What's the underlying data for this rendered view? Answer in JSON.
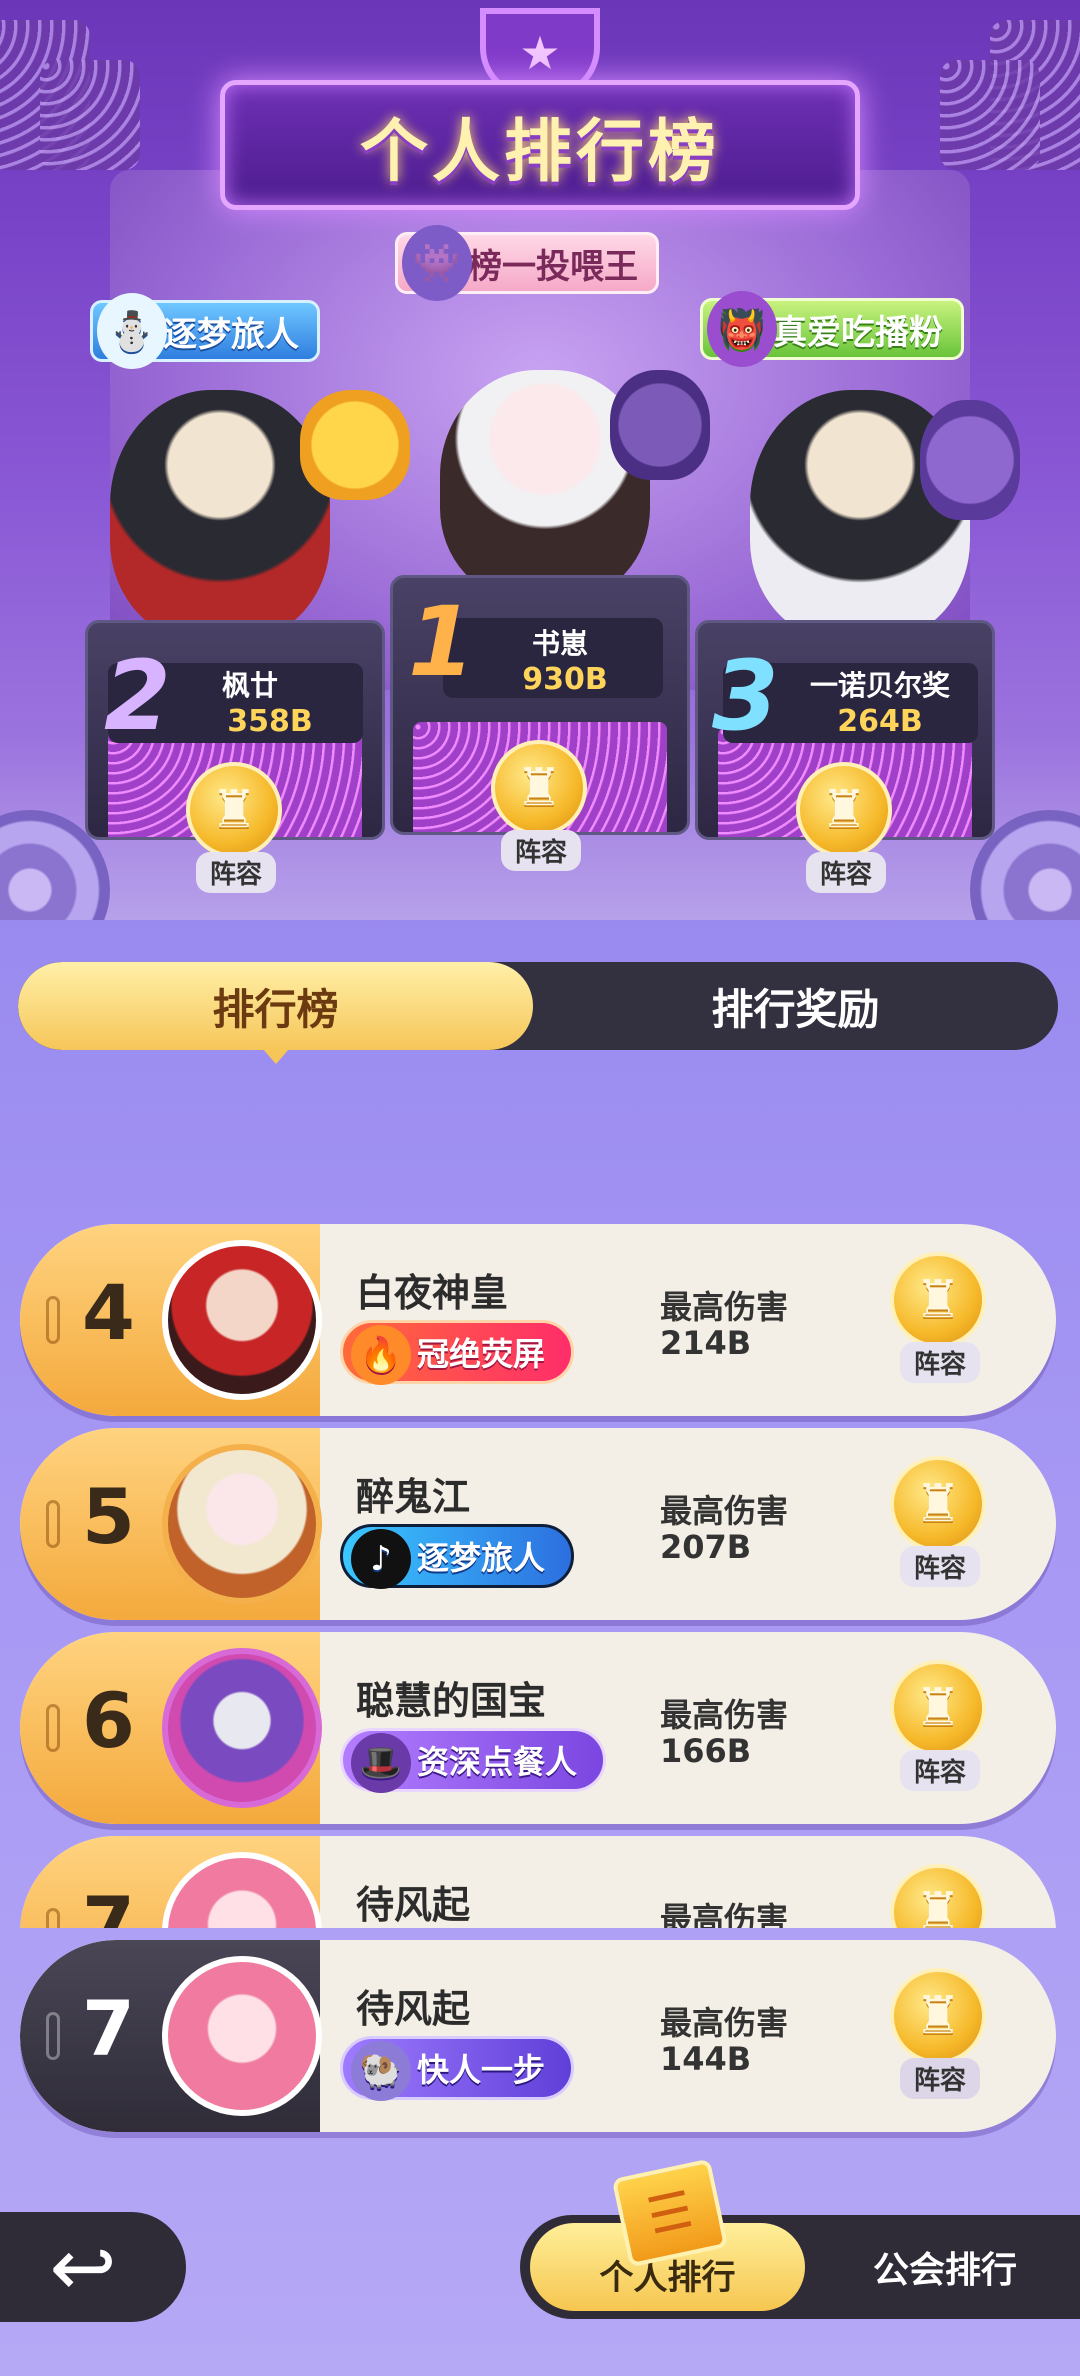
{
  "header": {
    "title": "个人排行榜",
    "tags": {
      "left": "逐梦旅人",
      "center": "榜一投喂王",
      "right": "真爱吃播粉"
    }
  },
  "podium": [
    {
      "rank": "2",
      "name": "枫廿",
      "score": "358B",
      "lineup": "阵容"
    },
    {
      "rank": "1",
      "name": "书崽",
      "score": "930B",
      "lineup": "阵容"
    },
    {
      "rank": "3",
      "name": "一诺贝尔奖",
      "score": "264B",
      "lineup": "阵容"
    }
  ],
  "tabs": {
    "ranking": "排行榜",
    "rewards": "排行奖励"
  },
  "list": [
    {
      "rank": "4",
      "name": "白夜神皇",
      "badge": "冠绝荧屏",
      "dmg_label": "最高伤害",
      "dmg": "214B",
      "lineup": "阵容"
    },
    {
      "rank": "5",
      "name": "醉鬼江",
      "badge": "逐梦旅人",
      "dmg_label": "最高伤害",
      "dmg": "207B",
      "lineup": "阵容"
    },
    {
      "rank": "6",
      "name": "聪慧的国宝",
      "badge": "资深点餐人",
      "dmg_label": "最高伤害",
      "dmg": "166B",
      "lineup": "阵容"
    },
    {
      "rank": "7",
      "name": "待风起",
      "badge": "",
      "dmg_label": "最高伤害",
      "dmg": "",
      "lineup": "阵容"
    }
  ],
  "me": {
    "rank": "7",
    "name": "待风起",
    "badge": "快人一步",
    "dmg_label": "最高伤害",
    "dmg": "144B",
    "lineup": "阵容"
  },
  "bottom": {
    "personal": "个人排行",
    "guild": "公会排行"
  },
  "colors": {
    "gold": "#f6c659",
    "dark": "#2f2c38",
    "purple": "#8b5ad6"
  }
}
